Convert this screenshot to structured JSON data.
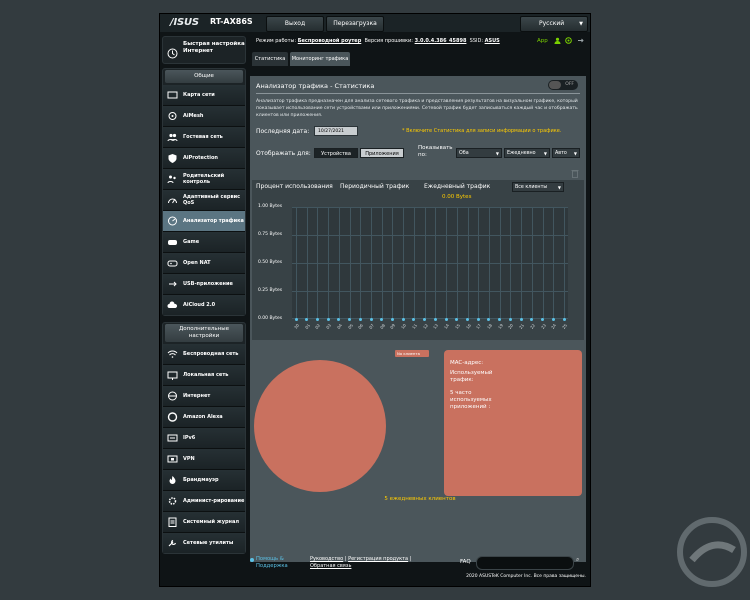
{
  "header": {
    "logo": "/ISUS",
    "model": "RT-AX86S",
    "logout_label": "Выход",
    "reboot_label": "Перезагрузка",
    "language": "Русский"
  },
  "status_bar": {
    "mode_label": "Режим работы:",
    "mode_value": "Беспроводной роутер",
    "firmware_label": "Версия прошивки:",
    "firmware_value": "3.0.0.4.386_45898",
    "ssid_label": "SSID:",
    "ssid_value": "ASUS",
    "app_label": "App"
  },
  "sidebar": {
    "quick_setup": "Быстрая настройка Интернет",
    "general_title": "Общие",
    "general_items": [
      {
        "label": "Карта сети",
        "icon": "network-map-icon"
      },
      {
        "label": "AiMesh",
        "icon": "aimesh-icon"
      },
      {
        "label": "Гостевая сеть",
        "icon": "guest-network-icon"
      },
      {
        "label": "AiProtection",
        "icon": "shield-icon"
      },
      {
        "label": "Родительский контроль",
        "icon": "parental-control-icon"
      },
      {
        "label": "Адаптивный сервис QoS",
        "icon": "qos-icon"
      },
      {
        "label": "Анализатор трафика",
        "icon": "traffic-analyzer-icon",
        "active": true
      },
      {
        "label": "Game",
        "icon": "gamepad-icon"
      },
      {
        "label": "Open NAT",
        "icon": "open-nat-icon"
      },
      {
        "label": "USB-приложение",
        "icon": "usb-icon"
      },
      {
        "label": "AiCloud 2.0",
        "icon": "cloud-icon"
      }
    ],
    "advanced_title": "Дополнительные настройки",
    "advanced_items": [
      {
        "label": "Беспроводная сеть",
        "icon": "wireless-icon"
      },
      {
        "label": "Локальная сеть",
        "icon": "lan-icon"
      },
      {
        "label": "Интернет",
        "icon": "globe-icon"
      },
      {
        "label": "Amazon Alexa",
        "icon": "alexa-icon"
      },
      {
        "label": "IPv6",
        "icon": "ipv6-icon"
      },
      {
        "label": "VPN",
        "icon": "vpn-icon"
      },
      {
        "label": "Брандмауэр",
        "icon": "firewall-icon"
      },
      {
        "label": "Админист-рирование",
        "icon": "administration-icon"
      },
      {
        "label": "Системный журнал",
        "icon": "system-log-icon"
      },
      {
        "label": "Сетевые утилиты",
        "icon": "network-tools-icon"
      }
    ]
  },
  "tabs": {
    "statistics": "Статистика",
    "monitoring": "Мониторинг трафика"
  },
  "panel": {
    "title": "Анализатор трафика - Статистика",
    "toggle": "OFF",
    "description": "Анализатор трафика предназначен для анализа сетевого трафика и представления результатов на визуальном графике, который показывает использование сети устройствами или приложениями. Сетевой трафик будет записываться каждый час и отображать клиентов или приложения.",
    "last_date_label": "Последняя дата:",
    "last_date_value": "10/27/2021",
    "hint": "* Включите Статистика для записи информации о трафике.",
    "display_label": "Отображать для:",
    "btn_devices": "Устройства",
    "btn_apps": "Приложения",
    "show_label": "Показывать по:",
    "show_both": "Оба",
    "show_period": "Ежедневно",
    "show_auto": "Авто"
  },
  "chart_tabs": {
    "percent": "Процент использования",
    "periodic": "Периодичный трафик",
    "daily": "Ежедневный трафик",
    "daily_value": "0.00 Bytes",
    "clients_select": "Все клиенты"
  },
  "chart_data": {
    "type": "scatter",
    "y_ticks": [
      "1.00 Bytes",
      "0.75 Bytes",
      "0.50 Bytes",
      "0.25 Bytes",
      "0.00 Bytes"
    ],
    "x": [
      "30",
      "01",
      "02",
      "03",
      "04",
      "05",
      "06",
      "07",
      "08",
      "09",
      "10",
      "11",
      "12",
      "13",
      "14",
      "15",
      "16",
      "17",
      "18",
      "19",
      "20",
      "21",
      "22",
      "23",
      "24",
      "25"
    ],
    "values": [
      0,
      0,
      0,
      0,
      0,
      0,
      0,
      0,
      0,
      0,
      0,
      0,
      0,
      0,
      0,
      0,
      0,
      0,
      0,
      0,
      0,
      0,
      0,
      0,
      0,
      0
    ],
    "ylim": [
      0,
      1
    ]
  },
  "pie": {
    "label": "No клиента",
    "mac": "MAC-адрес:",
    "used": "Используемый трафик:",
    "top_apps": "5 часто используемых приложений :",
    "clients_count": "5 ежедневных клиентов"
  },
  "footer": {
    "help": "Помощь & Поддержка",
    "link_manual": "Руководство",
    "link_register": "Регистрация продукта",
    "link_feedback": "Обратная связь",
    "faq": "FAQ",
    "copyright": "2020 ASUSTeK Computer Inc. Все права защищены."
  }
}
